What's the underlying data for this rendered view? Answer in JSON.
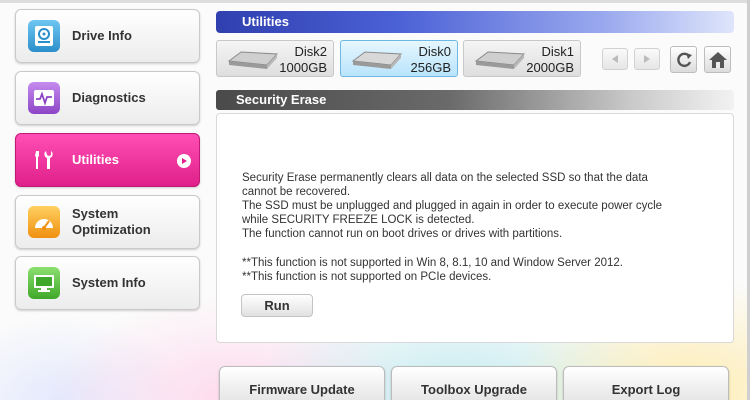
{
  "sidebar": {
    "items": [
      {
        "label": "Drive Info",
        "icon": "drive-icon",
        "color": "#3aa0d8"
      },
      {
        "label": "Diagnostics",
        "icon": "waveform-icon",
        "color": "#a866d6"
      },
      {
        "label": "Utilities",
        "icon": "tools-icon",
        "color": "#e0208a",
        "active": true
      },
      {
        "label_line1": "System",
        "label_line2": "Optimization",
        "icon": "gauge-icon",
        "color": "#f0a020"
      },
      {
        "label": "System Info",
        "icon": "computer-icon",
        "color": "#5cc040"
      }
    ]
  },
  "header": {
    "title": "Utilities"
  },
  "disks": [
    {
      "name": "Disk2",
      "size": "1000GB",
      "selected": false
    },
    {
      "name": "Disk0",
      "size": "256GB",
      "selected": true
    },
    {
      "name": "Disk1",
      "size": "2000GB",
      "selected": false
    }
  ],
  "section": {
    "title": "Security Erase",
    "description_lines": [
      "Security Erase permanently clears all data on the selected SSD so that the data",
      "cannot be recovered.",
      "The SSD must be unplugged and plugged in again in order to execute power cycle",
      "while SECURITY FREEZE LOCK is detected.",
      "The function cannot run on boot drives or drives with partitions."
    ],
    "notes": [
      "**This function is not supported in Win 8, 8.1, 10 and Window Server 2012.",
      "**This function is not supported on PCIe devices."
    ],
    "run_label": "Run"
  },
  "bottom_buttons": {
    "firmware": "Firmware Update",
    "toolbox": "Toolbox Upgrade",
    "export": "Export Log"
  },
  "colors": {
    "accent_active": "#e0208a",
    "header_blue": "#2f3fae"
  }
}
